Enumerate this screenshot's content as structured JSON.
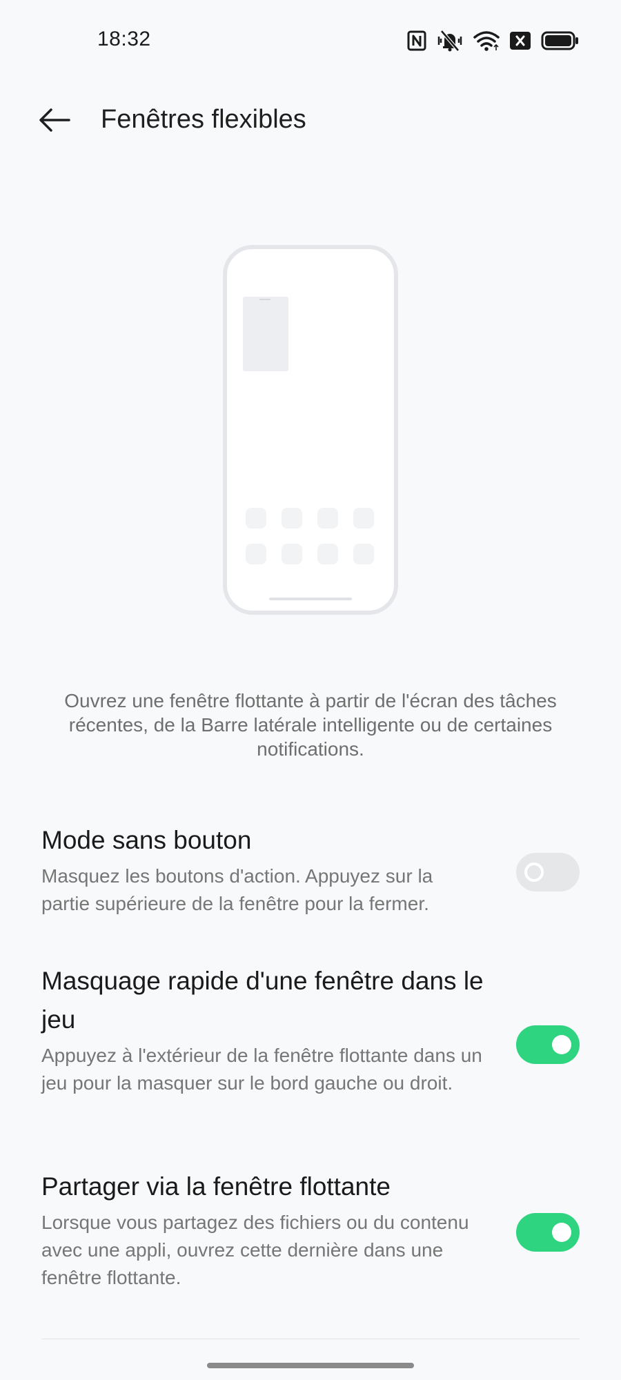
{
  "status_bar": {
    "time": "18:32",
    "icons": [
      "nfc-icon",
      "vibrate-icon",
      "wifi-icon",
      "sim-error-icon",
      "battery-icon"
    ]
  },
  "header": {
    "title": "Fenêtres flexibles",
    "back_icon": "arrow-left-icon"
  },
  "intro": {
    "text": "Ouvrez une fenêtre flottante à partir de l'écran des tâches récentes, de la Barre latérale intelligente ou de certaines notifications."
  },
  "settings": [
    {
      "title": "Mode sans bouton",
      "description": "Masquez les boutons d'action. Appuyez sur la partie supérieure de la fenêtre pour la fermer.",
      "enabled": false
    },
    {
      "title": "Masquage rapide d'une fenêtre dans le jeu",
      "description": "Appuyez à l'extérieur de la fenêtre flottante dans un jeu pour la masquer sur le bord gauche ou droit.",
      "enabled": true
    },
    {
      "title": "Partager via la fenêtre flottante",
      "description": "Lorsque vous partagez des fichiers ou du contenu avec une appli, ouvrez cette dernière dans une fenêtre flottante.",
      "enabled": true
    }
  ],
  "colors": {
    "toggle_on": "#2ed47f",
    "toggle_off": "#e6e7e9",
    "background": "#f8f9fa"
  }
}
